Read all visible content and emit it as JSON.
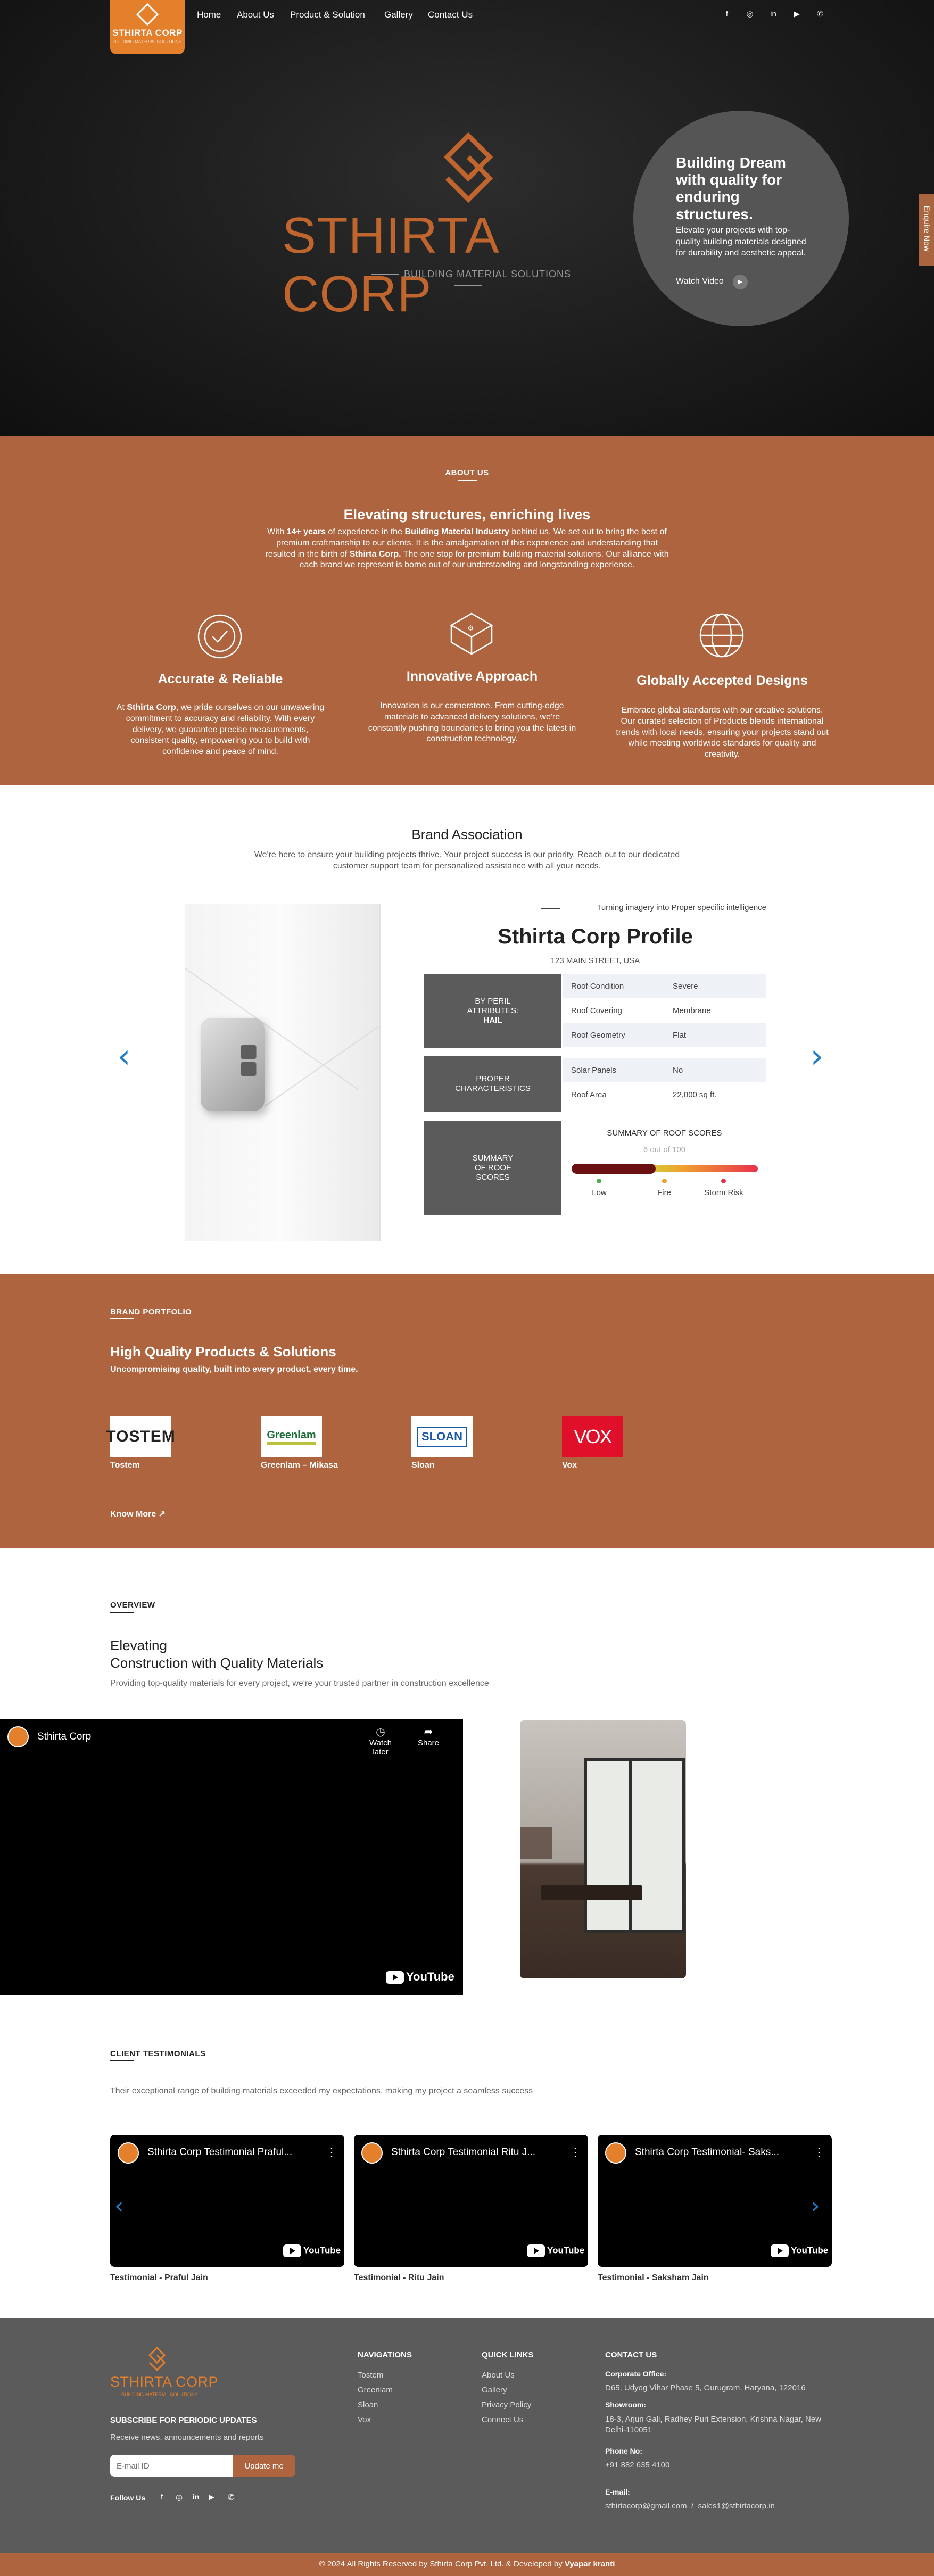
{
  "header": {
    "logo_text": "STHIRTA CORP",
    "logo_sub": "BUILDING MATERIAL SOLUTIONS",
    "nav": [
      "Home",
      "About Us",
      "Product & Solution",
      "Gallery",
      "Contact Us"
    ],
    "social_icons": [
      "facebook-icon",
      "instagram-icon",
      "linkedin-icon",
      "youtube-icon",
      "whatsapp-icon"
    ]
  },
  "hero": {
    "brand_title": "STHIRTA CORP",
    "brand_sub": "BUILDING MATERIAL SOLUTIONS",
    "circle_title": "Building Dream with quality for enduring structures.",
    "circle_text": "Elevate your projects with top-quality building materials designed for durability and aesthetic appeal.",
    "watch_label": "Watch Video",
    "enquiry_tab": "Enquire Now"
  },
  "about": {
    "label": "ABOUT US",
    "heading": "Elevating structures, enriching lives",
    "text_parts": [
      "With ",
      "14+ years",
      " of experience in the ",
      "Building Material Industry",
      " behind us. We set out to bring the best of premium craftmanship to our clients. It is the amalgamation of this experience and understanding that resulted in the birth of ",
      "Sthirta Corp.",
      " The one stop for premium building material solutions. Our alliance with each brand we represent is borne out of our understanding and longstanding experience."
    ],
    "features": [
      {
        "title": "Accurate & Reliable",
        "text_pre": "At ",
        "text_bold": "Sthirta Corp",
        "text_post": ", we pride ourselves on our unwavering commitment to accuracy and reliability. With every delivery, we guarantee precise measurements, consistent quality, empowering you to build with confidence and peace of mind."
      },
      {
        "title": "Innovative Approach",
        "text": "Innovation is our cornerstone. From cutting-edge materials to advanced delivery solutions, we're constantly pushing boundaries to bring you the latest in construction technology."
      },
      {
        "title": "Globally Accepted Designs",
        "text": "Embrace global standards with our creative solutions. Our curated selection of Products blends international trends with local needs, ensuring your projects stand out while meeting worldwide standards for quality and creativity."
      }
    ]
  },
  "brand_association": {
    "title": "Brand Association",
    "text": "We're here to ensure your building projects thrive. Your project success is our priority. Reach out to our dedicated customer support team for personalized assistance with all your needs.",
    "tagline": "Turning imagery into Proper specific intelligence",
    "profile_title": "Sthirta Corp Profile",
    "address": "123 MAIN STREET, USA",
    "groups": [
      {
        "label_lines": [
          "BY PERIL",
          "ATTRIBUTES:"
        ],
        "label_bold": "HAIL",
        "rows": [
          [
            "Roof Condition",
            "Severe"
          ],
          [
            "Roof Covering",
            "Membrane"
          ],
          [
            "Roof Geometry",
            "Flat"
          ]
        ]
      },
      {
        "label_lines": [
          "PROPER",
          "CHARACTERISTICS"
        ],
        "rows": [
          [
            "Solar Panels",
            "No"
          ],
          [
            "Roof Area",
            "22,000 sq ft."
          ]
        ]
      },
      {
        "label_lines": [
          "SUMMARY",
          "OF ROOF",
          "SCORES"
        ]
      }
    ],
    "score_title": "SUMMARY OF ROOF SCORES",
    "score_value": "6 out of 100",
    "score_fraction": 0.06,
    "score_labels": [
      "Low",
      "Fire",
      "Storm Risk"
    ],
    "score_colors": [
      "#4cae4c",
      "#f0a030",
      "#e8324c"
    ]
  },
  "portfolio": {
    "label": "BRAND PORTFOLIO",
    "heading": "High Quality Products & Solutions",
    "subheading": "Uncompromising quality, built into every product, every time.",
    "brands": [
      {
        "name": "Tostem",
        "logo": "TOSTEM"
      },
      {
        "name": "Greenlam – Mikasa",
        "logo": "Greenlam"
      },
      {
        "name": "Sloan",
        "logo": "SLOAN"
      },
      {
        "name": "Vox",
        "logo": "VOX"
      }
    ],
    "know_more": "Know More"
  },
  "overview": {
    "label": "OVERVIEW",
    "title_line1": "Elevating",
    "title_line2": "Construction with Quality Materials",
    "text": "Providing top-quality materials for every project, we're your trusted partner in construction excellence",
    "video_channel": "Sthirta Corp",
    "watch_later": "Watch later",
    "share": "Share",
    "youtube": "YouTube"
  },
  "testimonials": {
    "label": "CLIENT TESTIMONIALS",
    "text": "Their exceptional range of building materials exceeded my expectations, making my project a seamless success",
    "videos": [
      {
        "title": "Sthirta Corp Testimonial Praful...",
        "name": "Testimonial - Praful Jain"
      },
      {
        "title": "Sthirta Corp Testimonial Ritu J...",
        "name": "Testimonial - Ritu Jain"
      },
      {
        "title": "Sthirta Corp Testimonial- Saks...",
        "name": "Testimonial - Saksham Jain"
      }
    ]
  },
  "footer": {
    "logo_text": "STHIRTA CORP",
    "logo_sub": "BUILDING MATERIAL SOLUTIONS",
    "subscribe_title": "SUBSCRIBE FOR PERIODIC UPDATES",
    "subscribe_text": "Receive news, announcements and reports",
    "email_placeholder": "E-mail ID",
    "update_button": "Update me",
    "follow_us": "Follow Us",
    "nav_title": "NAVIGATIONS",
    "nav_links": [
      "Tostem",
      "Greenlam",
      "Sloan",
      "Vox"
    ],
    "quick_title": "QUICK LINKS",
    "quick_links": [
      "About Us",
      "Gallery",
      "Privacy Policy",
      "Connect Us"
    ],
    "contact_title": "CONTACT US",
    "corporate_label": "Corporate Office:",
    "corporate_address": "D65, Udyog Vihar Phase 5, Gurugram, Haryana, 122016",
    "showroom_label": "Showroom:",
    "showroom_address": "18-3, Arjun Gali, Radhey Puri Extension, Krishna Nagar, New Delhi-110051",
    "phone_label": "Phone No:",
    "phone": "+91 882 635 4100",
    "email_label": "E-mail:",
    "email": "sthirtacorp@gmail.com  /  sales1@sthirtacorp.in",
    "copyright": "© 2024 All Rights Reserved by Sthirta Corp Pvt. Ltd. & Developed by ",
    "developer": "Vyapar kranti"
  },
  "colors": {
    "accent": "#e47f2c",
    "section_brown": "#ae653f",
    "footer_gray": "#5b5b5b",
    "arrow_blue": "#1e7bc4"
  }
}
